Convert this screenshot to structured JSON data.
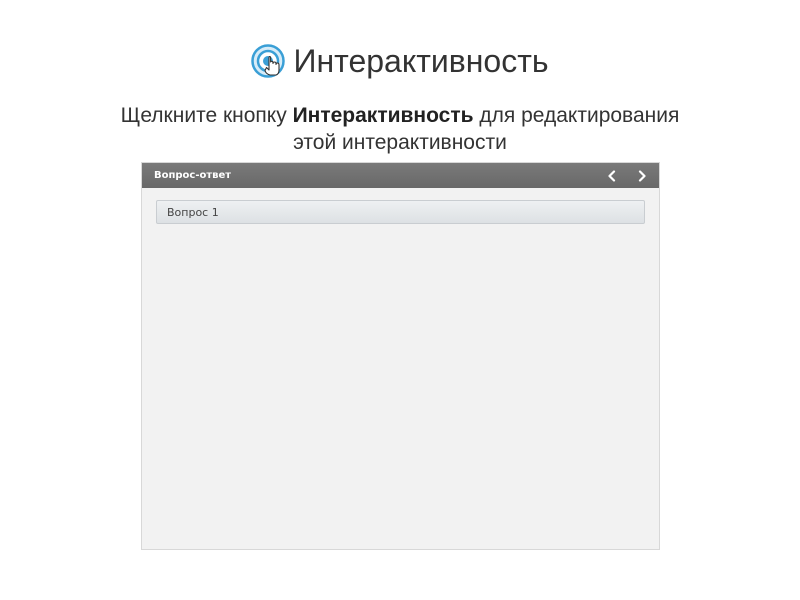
{
  "header": {
    "title": "Интерактивность",
    "icon": "touch-target-icon"
  },
  "instruction": {
    "prefix": "Щелкните кнопку ",
    "bold": "Интерактивность",
    "suffix": " для редактирования",
    "line2": "этой интерактивности"
  },
  "panel": {
    "title": "Вопрос-ответ",
    "prev_icon": "chevron-left-icon",
    "next_icon": "chevron-right-icon",
    "items": [
      {
        "label": "Вопрос 1"
      }
    ]
  },
  "colors": {
    "accent": "#3a9fd6",
    "header_bg": "#707070"
  }
}
